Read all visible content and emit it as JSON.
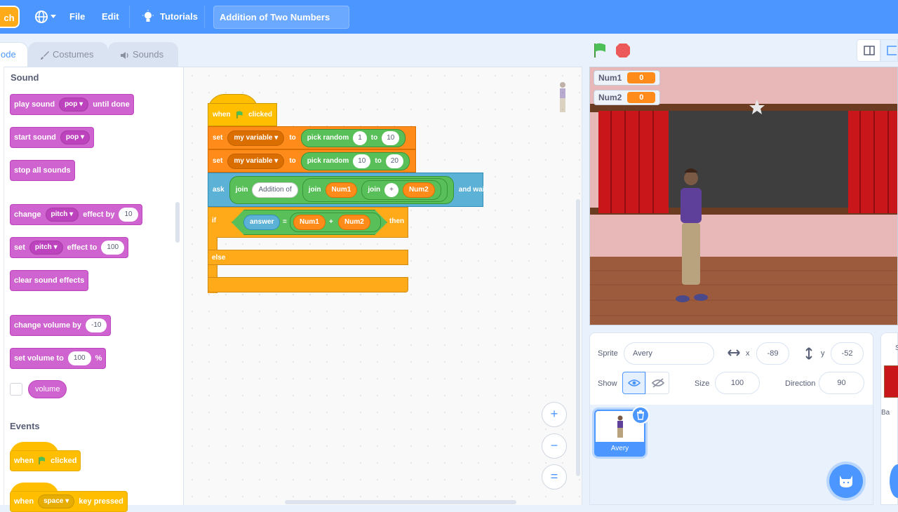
{
  "menu": {
    "logo_text": "ch",
    "file": "File",
    "edit": "Edit",
    "tutorials": "Tutorials",
    "project_title": "Addition of Two Numbers"
  },
  "tabs": {
    "code": "ode",
    "costumes": "Costumes",
    "sounds": "Sounds"
  },
  "palette": {
    "sound_title": "Sound",
    "play_sound": {
      "label": "play sound",
      "menu": "pop",
      "suffix": "until done"
    },
    "start_sound": {
      "label": "start sound",
      "menu": "pop"
    },
    "stop_all_sounds": "stop all sounds",
    "change_effect": {
      "label": "change",
      "menu": "pitch",
      "mid": "effect by",
      "value": "10"
    },
    "set_effect": {
      "label": "set",
      "menu": "pitch",
      "mid": "effect to",
      "value": "100"
    },
    "clear_sound_effects": "clear sound effects",
    "change_volume": {
      "label": "change volume by",
      "value": "-10"
    },
    "set_volume": {
      "label": "set volume to",
      "value": "100",
      "suffix": "%"
    },
    "volume_reporter": "volume",
    "events_title": "Events",
    "when_flag": {
      "prefix": "when",
      "suffix": "clicked"
    },
    "when_key": {
      "prefix": "when",
      "menu": "space",
      "suffix": "key pressed"
    }
  },
  "script": {
    "hat": {
      "prefix": "when",
      "suffix": "clicked"
    },
    "set1": {
      "label": "set",
      "variable": "my variable",
      "to": "to",
      "op": "pick random",
      "from": "1",
      "to_word": "to",
      "max": "10"
    },
    "set2": {
      "label": "set",
      "variable": "my variable",
      "to": "to",
      "op": "pick random",
      "from": "10",
      "to_word": "to",
      "max": "20"
    },
    "ask": {
      "label": "ask",
      "join1": "join",
      "text": "Addition of",
      "join2": "join",
      "var1": "Num1",
      "join3": "join",
      "plus": "+",
      "var2": "Num2",
      "suffix": "and wait"
    },
    "if": {
      "label": "if",
      "answer": "answer",
      "eq": "=",
      "var1": "Num1",
      "plus": "+",
      "var2": "Num2",
      "then": "then",
      "else": "else"
    }
  },
  "zoom": {
    "in": "+",
    "out": "−",
    "reset": "="
  },
  "stage": {
    "monitors": [
      {
        "name": "Num1",
        "value": "0"
      },
      {
        "name": "Num2",
        "value": "0"
      }
    ]
  },
  "sprite_info": {
    "sprite_label": "Sprite",
    "sprite_name": "Avery",
    "x_label": "x",
    "x_value": "-89",
    "y_label": "y",
    "y_value": "-52",
    "show_label": "Show",
    "size_label": "Size",
    "size_value": "100",
    "direction_label": "Direction",
    "direction_value": "90"
  },
  "sprites": [
    {
      "name": "Avery",
      "selected": true
    }
  ],
  "stage_pane": {
    "label_partial": "S",
    "backdrop_label": "Ba"
  },
  "colors": {
    "menu_blue": "#4c97ff",
    "sound_purple": "#cf63cf",
    "event_yellow": "#ffbf00",
    "variable_orange": "#ff8c1a",
    "operator_green": "#59c059",
    "sensing_blue": "#5cb1d6",
    "control_orange": "#ffab19"
  }
}
